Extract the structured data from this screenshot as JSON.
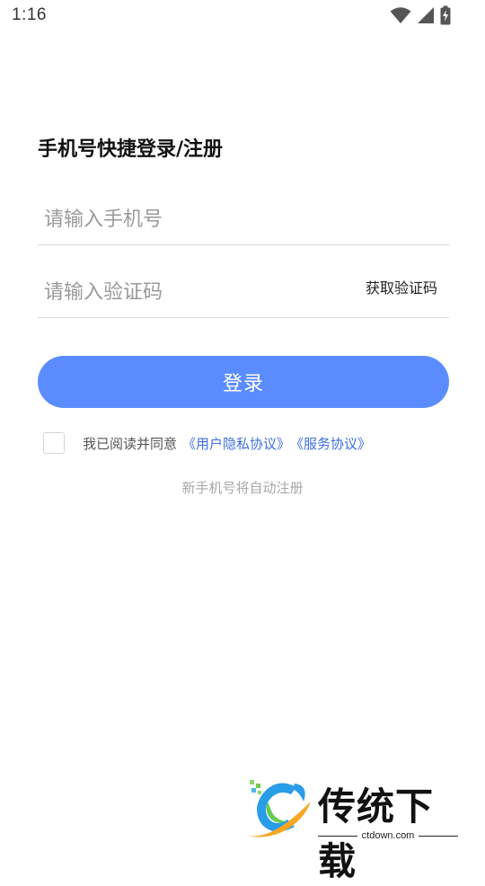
{
  "status_bar": {
    "time": "1:16",
    "icons": [
      "wifi-icon",
      "cell-signal-icon",
      "battery-charging-icon"
    ]
  },
  "login": {
    "title": "手机号快捷登录/注册",
    "phone_placeholder": "请输入手机号",
    "phone_value": "",
    "code_placeholder": "请输入验证码",
    "code_value": "",
    "get_code_label": "获取验证码",
    "login_label": "登录",
    "agree_checked": false,
    "agree_prefix": "我已阅读并同意",
    "privacy_link": "《用户隐私协议》",
    "service_link": "《服务协议》",
    "auto_register_note": "新手机号将自动注册"
  },
  "watermark": {
    "brand": "传统下载",
    "domain": "ctdown.com"
  },
  "colors": {
    "primary_button": "#5b8cff",
    "link": "#3d6fe0",
    "placeholder": "#9a9a9a",
    "note": "#a8a8a8"
  }
}
